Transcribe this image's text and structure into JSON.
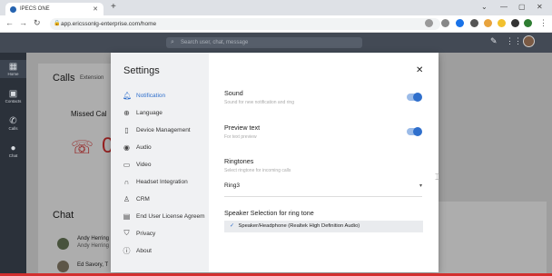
{
  "browser": {
    "tab_title": "IPECS ONE",
    "url": "app.ericssonlg-enterprise.com/home"
  },
  "app": {
    "search_placeholder": "Search user, chat, message",
    "rail": [
      {
        "label": "Home",
        "icon": "grid-icon"
      },
      {
        "label": "Contacts",
        "icon": "contacts-icon"
      },
      {
        "label": "Calls",
        "icon": "phone-icon"
      },
      {
        "label": "Chat",
        "icon": "chat-icon"
      }
    ],
    "background": {
      "calls_title": "Calls",
      "calls_ext": "Extension",
      "missed_label": "Missed Cal",
      "chat_title": "Chat",
      "chat_items": [
        "Andy Herring",
        "Andy Herring",
        "Ed Savory, T"
      ]
    }
  },
  "settings": {
    "title": "Settings",
    "menu": [
      {
        "label": "Notification",
        "icon": "bell-icon",
        "active": true
      },
      {
        "label": "Language",
        "icon": "globe-icon"
      },
      {
        "label": "Device Management",
        "icon": "device-icon"
      },
      {
        "label": "Audio",
        "icon": "audio-icon"
      },
      {
        "label": "Video",
        "icon": "video-icon"
      },
      {
        "label": "Headset Integration",
        "icon": "headset-icon"
      },
      {
        "label": "CRM",
        "icon": "person-icon"
      },
      {
        "label": "End User License Agreem",
        "icon": "license-icon"
      },
      {
        "label": "Privacy",
        "icon": "privacy-icon"
      },
      {
        "label": "About",
        "icon": "info-icon"
      }
    ],
    "sound": {
      "title": "Sound",
      "subtitle": "Sound for new notification and ring",
      "enabled": true
    },
    "preview": {
      "title": "Preview text",
      "subtitle": "For text preview",
      "enabled": true
    },
    "ringtones": {
      "title": "Ringtones",
      "subtitle": "Select ringtone for incoming calls",
      "value": "Ring3"
    },
    "speaker": {
      "title": "Speaker Selection for ring tone",
      "value": "Speaker/Headphone (Realtek High Definition Audio)"
    }
  }
}
